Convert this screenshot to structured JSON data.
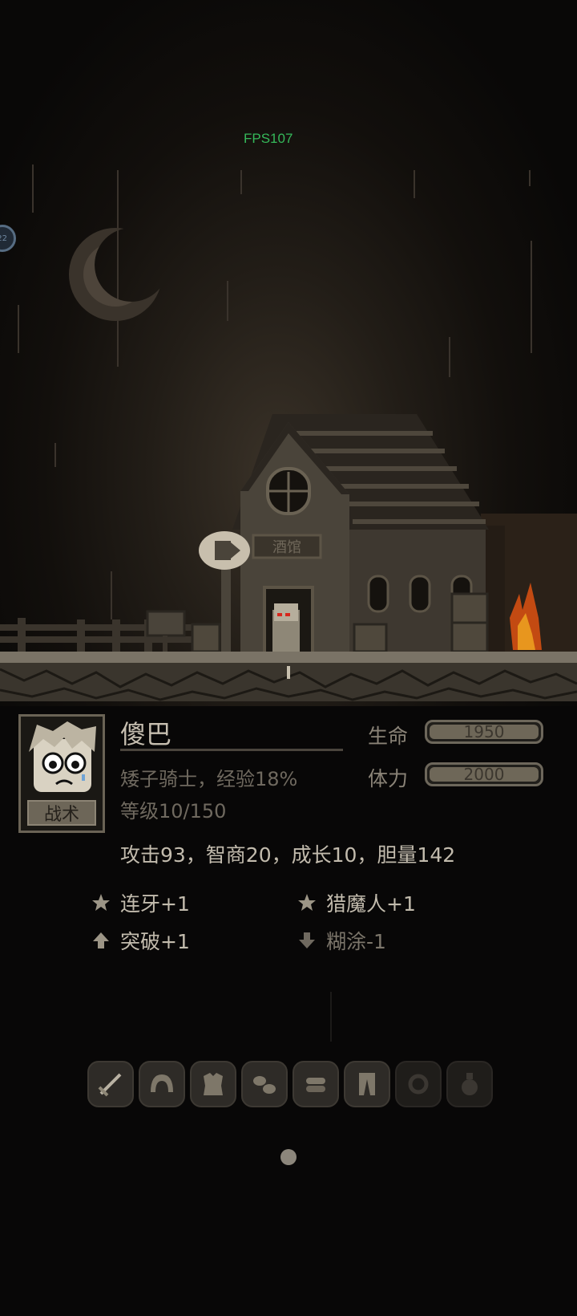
{
  "hud": {
    "fps": "FPS107",
    "side_badge": "22"
  },
  "scene": {
    "shop_sign": "酒馆",
    "colors": {
      "sky": "#090807",
      "fire": "#e0641e",
      "fps_text": "#35b85a"
    }
  },
  "character": {
    "name": "傻巴",
    "class_exp": "矮子骑士，经验18%",
    "level": "等级10/150",
    "tactics_button": "战术",
    "stats": {
      "hp_label": "生命",
      "hp_value": "1950",
      "stamina_label": "体力",
      "stamina_value": "2000"
    },
    "attributes": "攻击93，智商20，成长10，胆量142",
    "traits": [
      {
        "icon": "star-icon",
        "label": "连牙+1"
      },
      {
        "icon": "star-icon",
        "label": "猎魔人+1"
      },
      {
        "icon": "arrow-up-icon",
        "label": "突破+1"
      },
      {
        "icon": "arrow-down-icon",
        "label": "糊涂-1"
      }
    ]
  },
  "equipment": [
    {
      "icon": "sword-icon"
    },
    {
      "icon": "helmet-icon"
    },
    {
      "icon": "armor-icon"
    },
    {
      "icon": "gloves-icon"
    },
    {
      "icon": "boots-icon"
    },
    {
      "icon": "pants-icon"
    },
    {
      "icon": "ring-icon"
    },
    {
      "icon": "potion-icon"
    }
  ],
  "pager": {
    "current_page": 1,
    "total_pages": 1
  }
}
